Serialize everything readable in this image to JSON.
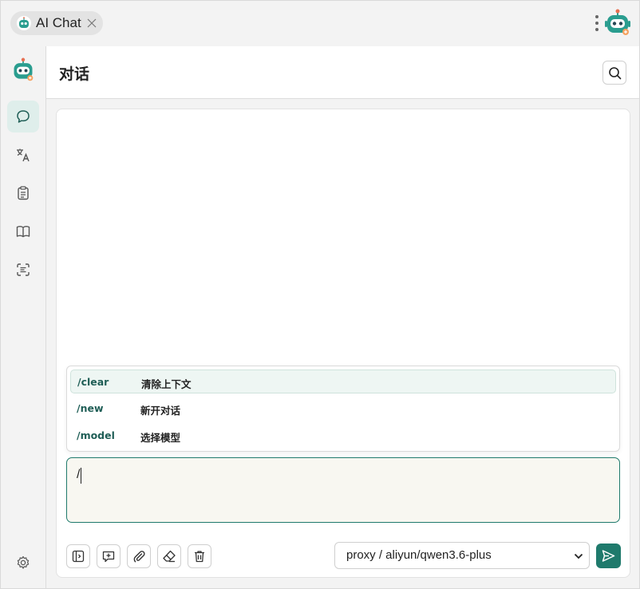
{
  "tab": {
    "title": "AI Chat",
    "icon": "robot-icon"
  },
  "topbar": {
    "menu_icon": "more-vertical-icon",
    "avatar_icon": "robot-icon"
  },
  "sidebar": {
    "items": [
      {
        "name": "chat",
        "icon": "chat-bubble-icon",
        "active": true
      },
      {
        "name": "translate",
        "icon": "translate-icon",
        "active": false
      },
      {
        "name": "clipboard",
        "icon": "clipboard-icon",
        "active": false
      },
      {
        "name": "book",
        "icon": "book-icon",
        "active": false
      },
      {
        "name": "scan-text",
        "icon": "scan-text-icon",
        "active": false
      }
    ],
    "settings_icon": "gear-icon"
  },
  "header": {
    "title": "对话",
    "search_icon": "search-icon"
  },
  "commands": [
    {
      "name": "/clear",
      "desc": "清除上下文",
      "active": true
    },
    {
      "name": "/new",
      "desc": "新开对话",
      "active": false
    },
    {
      "name": "/model",
      "desc": "选择模型",
      "active": false
    }
  ],
  "input": {
    "value": "/"
  },
  "toolbar": {
    "buttons": [
      "sidebar-toggle-icon",
      "prompt-icon",
      "paperclip-icon",
      "eraser-icon",
      "trash-icon"
    ],
    "model_select": "proxy / aliyun/qwen3.6-plus",
    "send_icon": "send-icon"
  },
  "colors": {
    "accent": "#1f7a6c",
    "active_bg": "#dfeeeb",
    "command_text": "#1f5e56"
  }
}
